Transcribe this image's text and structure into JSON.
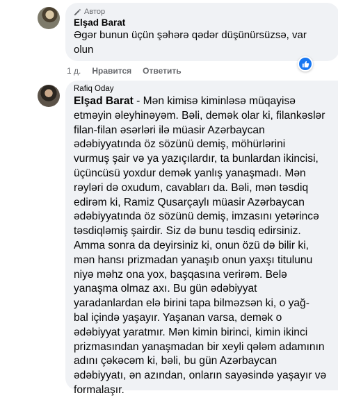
{
  "comment1": {
    "badge": "Автор",
    "author": "Elşad Barat",
    "text": "Əgər bunun üçün şəhərə qədər düşünürsüzsə, var\nolun",
    "time": "1 д.",
    "like_label": "Нравится",
    "reply_label": "Ответить",
    "reaction_icon": "thumbs-up-icon",
    "reaction_color": "#1877f2"
  },
  "comment2": {
    "author": "Rafiq Oday",
    "mention": "Elşad Barat",
    "text": " - Mən kimisə kiminləsə müqayisə\netməyin əleyhinəyəm. Bəli, demək olar ki, filankəslər\nfilan-filan əsərləri ilə müasir Azərbaycan\nədəbiyyatında öz sözünü demiş, möhürlərini\nvurmuş şair və ya yazıçılardır, ta bunlardan ikincisi,\nüçüncüsü yoxdur demək yanlış yanaşmadı. Mən\nrəyləri də oxudum, cavabları da. Bəli, mən təsdiq\nedirəm ki, Ramiz Qusarçaylı müasir Azərbaycan\nədəbiyyatında öz sözünü demiş, imzasını yetərincə\ntəsdiqləmiş şairdir. Siz də bunu təsdiq edirsiniz.\nAmma sonra da deyirsiniz ki, onun özü də bilir ki,\nmən hansı prizmadan yanaşıb onun yaxşı titulunu\nniyə məhz ona yox, başqasına verirəm. Belə\nyanaşma olmaz axı. Bu gün ədəbiyyat\nyaradanlardan elə birini tapa bilməzsən ki, o yağ-\nbal içində yaşayır. Yaşanan varsa, demək o\nədəbiyyat yaratmır. Mən kimin birinci, kimin ikinci\nprizmasından yanaşmadan bir xeyli qələm adamının\nadını çəkəcəm ki, bəli, bu gün Azərbaycan\nədəbiyyatı, ən azından, onların sayəsində yaşayır və\nformalaşır."
  }
}
